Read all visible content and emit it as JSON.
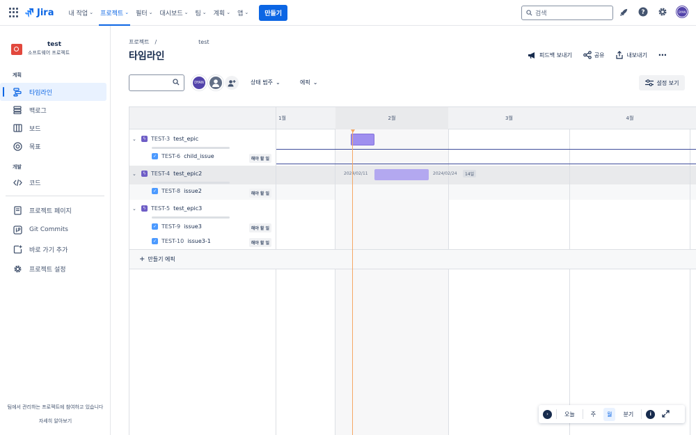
{
  "topnav": {
    "brand": "Jira",
    "items": [
      {
        "label": "내 작업"
      },
      {
        "label": "프로젝트"
      },
      {
        "label": "필터"
      },
      {
        "label": "대시보드"
      },
      {
        "label": "팀"
      },
      {
        "label": "계획"
      },
      {
        "label": "앱"
      }
    ],
    "create_label": "만들기",
    "search_placeholder": "검색",
    "avatar_initials": "DYAN"
  },
  "sidebar": {
    "project_name": "test",
    "project_type": "소프트웨어 프로젝트",
    "section_plan": "계획",
    "plan_items": [
      {
        "label": "타임라인"
      },
      {
        "label": "백로그"
      },
      {
        "label": "보드"
      },
      {
        "label": "목표"
      }
    ],
    "section_dev": "개발",
    "dev_items": [
      {
        "label": "코드"
      }
    ],
    "other_items": [
      {
        "label": "프로젝트 페이지"
      },
      {
        "label": "Git Commits"
      },
      {
        "label": "바로 가기 추가"
      },
      {
        "label": "프로젝트 설정"
      }
    ],
    "footer_text": "팀에서 관리하는 프로젝트에 참여하고 있습니다",
    "footer_link": "자세히 알아보기"
  },
  "header": {
    "breadcrumb_root": "프로젝트",
    "breadcrumb_sep": "/",
    "breadcrumb_current": "test",
    "title": "타임라인",
    "actions": [
      {
        "label": "피드백 보내기"
      },
      {
        "label": "공유"
      },
      {
        "label": "내보내기"
      }
    ]
  },
  "filters": {
    "avatar_initials": "DYAN",
    "status_label": "상태 범주",
    "epic_label": "에픽",
    "view_settings": "설정 보기"
  },
  "timeline": {
    "months": [
      {
        "label": "1월"
      },
      {
        "label": "2월"
      },
      {
        "label": "3월"
      },
      {
        "label": "4월"
      }
    ],
    "rows": [
      {
        "key": "TEST-3",
        "summary": "test_epic",
        "type": "epic"
      },
      {
        "key": "TEST-6",
        "summary": "child_issue",
        "type": "task",
        "status": "해야 할 일"
      },
      {
        "key": "TEST-4",
        "summary": "test_epic2",
        "type": "epic"
      },
      {
        "key": "TEST-8",
        "summary": "issue2",
        "type": "task",
        "status": "해야 할 일"
      },
      {
        "key": "TEST-5",
        "summary": "test_epic3",
        "type": "epic"
      },
      {
        "key": "TEST-9",
        "summary": "issue3",
        "type": "task",
        "status": "해야 할 일"
      },
      {
        "key": "TEST-10",
        "summary": "issue3-1",
        "type": "task",
        "status": "해야 할 일"
      }
    ],
    "epic2_start": "2024/02/11",
    "epic2_end": "2024/02/24",
    "epic2_duration": "14일",
    "create_epic_label": "만들기 에픽"
  },
  "zoom": {
    "today": "오늘",
    "week": "주",
    "month": "월",
    "quarter": "분기",
    "active": "월"
  },
  "colors": {
    "accent": "#0c66e4",
    "epic": "#6e5dc6",
    "today_line": "#f5a764"
  }
}
